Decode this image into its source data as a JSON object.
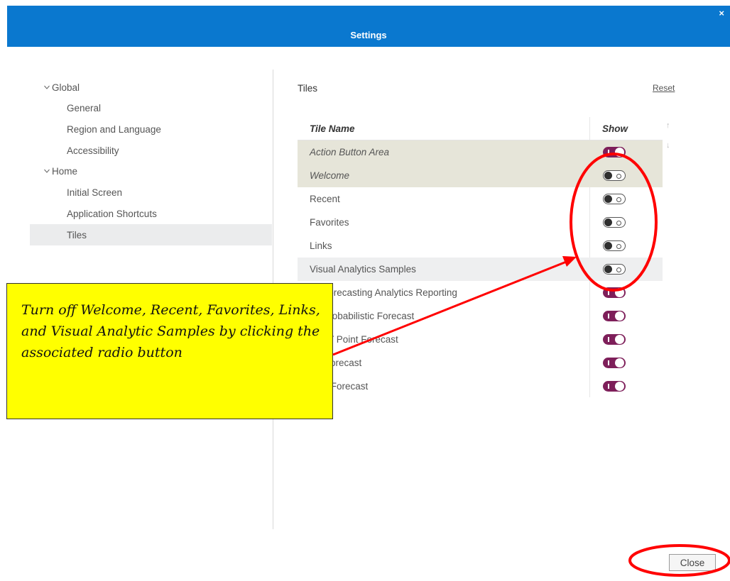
{
  "dialog": {
    "title": "Settings",
    "close_icon": "×"
  },
  "nav": {
    "groups": [
      {
        "label": "Global",
        "items": [
          "General",
          "Region and Language",
          "Accessibility"
        ]
      },
      {
        "label": "Home",
        "items": [
          "Initial Screen",
          "Application Shortcuts",
          "Tiles"
        ]
      }
    ],
    "selected": "Tiles"
  },
  "panel": {
    "title": "Tiles",
    "reset_label": "Reset",
    "columns": {
      "name": "Tile Name",
      "show": "Show"
    },
    "rows": [
      {
        "name": "Action Button Area",
        "show": true
      },
      {
        "name": "Welcome",
        "show": false
      },
      {
        "name": "Recent",
        "show": false
      },
      {
        "name": "Favorites",
        "show": false
      },
      {
        "name": "Links",
        "show": false
      },
      {
        "name": "Visual Analytics Samples",
        "show": false
      },
      {
        "name": "gy Forecasting Analytics Reporting",
        "show": true
      },
      {
        "name": "LT Probabilistic Forecast",
        "show": true
      },
      {
        "name": "MTLT Point Forecast",
        "show": true
      },
      {
        "name": "ST Forecast",
        "show": true
      },
      {
        "name": "VST Forecast",
        "show": true
      }
    ],
    "move_up_icon": "↑",
    "move_down_icon": "↓"
  },
  "callout": {
    "text": "Turn off Welcome, Recent, Favorites, Links, and Visual Analytic Samples by clicking the associated radio button"
  },
  "footer": {
    "close_label": "Close"
  },
  "colors": {
    "header": "#0a78cf",
    "toggle_on": "#7e1f5a",
    "annotation": "#ff0000",
    "callout_bg": "#ffff00"
  }
}
